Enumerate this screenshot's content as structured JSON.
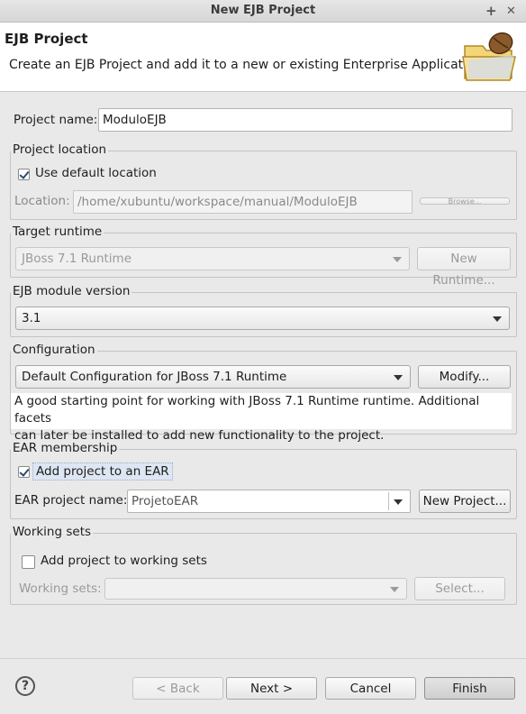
{
  "window": {
    "title": "New EJB Project",
    "maximize_glyph": "+",
    "close_glyph": "✕"
  },
  "header": {
    "title": "EJB Project",
    "description": "Create an EJB Project and add it to a new or existing Enterprise Application.",
    "icon": "folder-bean-icon"
  },
  "project_name": {
    "label": "Project name:",
    "value": "ModuloEJB"
  },
  "project_location": {
    "group_label": "Project location",
    "use_default_label": "Use default location",
    "use_default_checked": true,
    "location_label": "Location:",
    "location_value": "/home/xubuntu/workspace/manual/ModuloEJB",
    "browse_label": "Browse..."
  },
  "target_runtime": {
    "group_label": "Target runtime",
    "selected": "JBoss 7.1 Runtime",
    "new_runtime_label": "New Runtime..."
  },
  "ejb_module_version": {
    "group_label": "EJB module version",
    "selected": "3.1"
  },
  "configuration": {
    "group_label": "Configuration",
    "selected": "Default Configuration for JBoss 7.1 Runtime",
    "modify_label": "Modify...",
    "description_line1": "A good starting point for working with JBoss 7.1 Runtime runtime. Additional facets",
    "description_line2": "can later be installed to add new functionality to the project."
  },
  "ear_membership": {
    "group_label": "EAR membership",
    "add_to_ear_label": "Add project to an EAR",
    "add_to_ear_checked": true,
    "ear_name_label": "EAR project name:",
    "ear_name_value": "ProjetoEAR",
    "new_project_label": "New Project..."
  },
  "working_sets": {
    "group_label": "Working sets",
    "add_label": "Add project to working sets",
    "add_checked": false,
    "sets_label": "Working sets:",
    "select_label": "Select..."
  },
  "footer": {
    "help_glyph": "?",
    "back_label": "< Back",
    "next_label": "Next >",
    "cancel_label": "Cancel",
    "finish_label": "Finish"
  }
}
